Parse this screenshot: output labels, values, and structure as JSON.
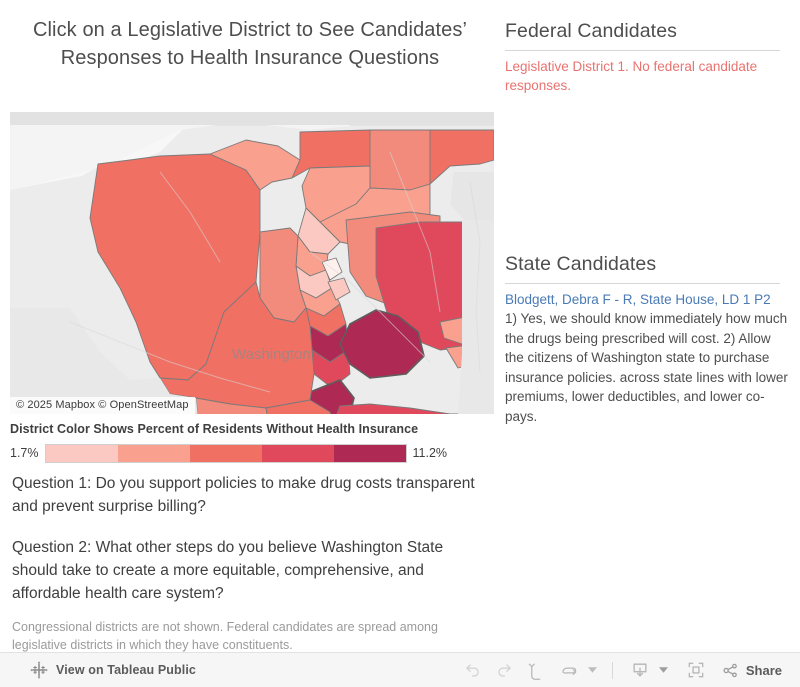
{
  "title": "Click on a Legislative District to See Candidates’ Responses to Health Insurance Questions",
  "map": {
    "state_label": "Washington",
    "attribution": "© 2025 Mapbox  © OpenStreetMap"
  },
  "legend": {
    "title": "District Color Shows Percent of Residents Without Health Insurance",
    "min_label": "1.7%",
    "max_label": "11.2%",
    "colors": [
      "#fbc9c1",
      "#f9a08f",
      "#f07064",
      "#e0485c",
      "#ae2a54"
    ]
  },
  "questions": {
    "q1": "Question 1: Do you support policies to make drug costs transparent and prevent surprise billing?",
    "q2": "Question 2: What other steps do you believe Washington State should take to create a more equitable, comprehensive, and affordable health care system?"
  },
  "footnote": "Congressional districts are not shown. Federal candidates are spread among legislative districts in which they have constituents.",
  "federal": {
    "heading": "Federal Candidates",
    "message": "Legislative District 1. No federal candidate responses."
  },
  "state": {
    "heading": "State Candidates",
    "candidate_name": "Blodgett, Debra F - R, State House, LD 1 P2",
    "candidate_answer": "1) Yes, we should know immediately how much the drugs being prescribed will cost. 2) Allow the citizens of Washington state to purchase insurance policies. across state lines with lower premiums, lower deductibles, and lower co-pays."
  },
  "toolbar": {
    "view_label": "View on Tableau Public",
    "share_label": "Share",
    "icons": {
      "logo": "tableau-logo-icon",
      "undo": "undo-icon",
      "redo": "redo-icon",
      "revert": "revert-icon",
      "refresh": "refresh-icon",
      "refresh_caret": "chevron-down-icon",
      "download": "download-icon",
      "download_caret": "chevron-down-icon",
      "fullscreen": "fullscreen-icon",
      "share": "share-icon"
    }
  },
  "chart_data": {
    "type": "heatmap",
    "title": "District Color Shows Percent of Residents Without Health Insurance",
    "legend_position": "below-map",
    "value_range": [
      1.7,
      11.2
    ],
    "unit": "percent",
    "bins": [
      {
        "color": "#fbc9c1",
        "range": [
          1.7,
          3.6
        ]
      },
      {
        "color": "#f9a08f",
        "range": [
          3.6,
          5.5
        ]
      },
      {
        "color": "#f07064",
        "range": [
          5.5,
          7.4
        ]
      },
      {
        "color": "#e0485c",
        "range": [
          7.4,
          9.3
        ]
      },
      {
        "color": "#ae2a54",
        "range": [
          9.3,
          11.2
        ]
      }
    ],
    "geography": "Washington State Legislative Districts",
    "selected_district": "Legislative District 1"
  }
}
